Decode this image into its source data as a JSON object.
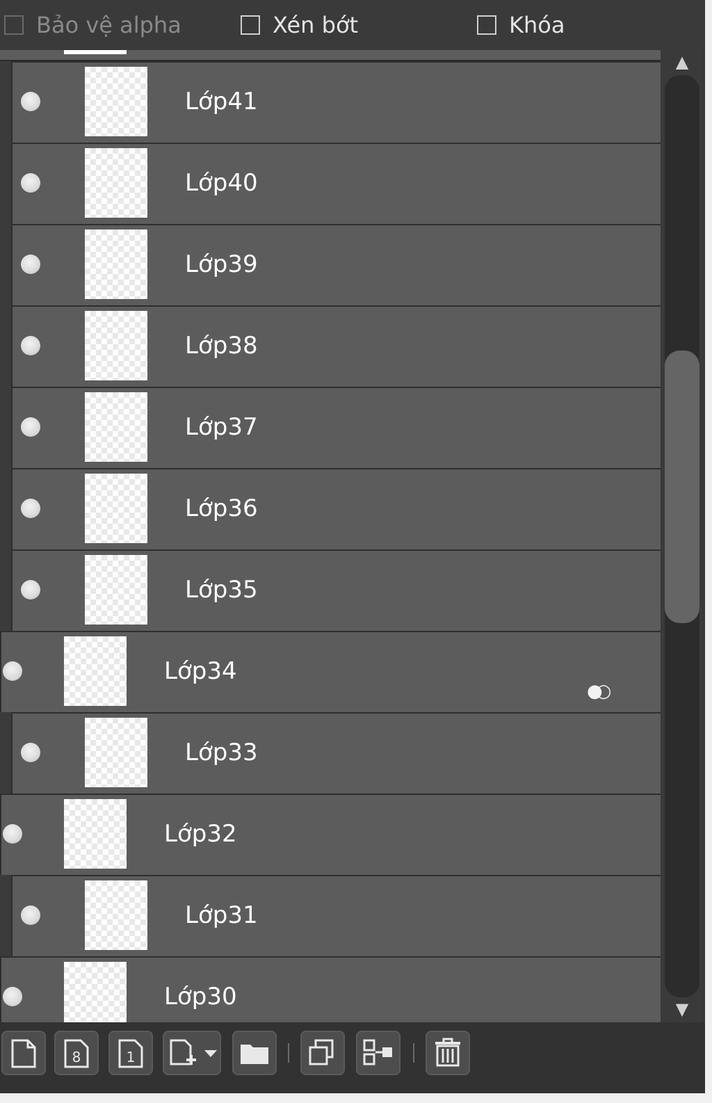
{
  "options": [
    {
      "label": "Bảo vệ alpha",
      "checked": false,
      "enabled": false
    },
    {
      "label": "Xén bớt",
      "checked": false,
      "enabled": true
    },
    {
      "label": "Khóa",
      "checked": false,
      "enabled": true
    }
  ],
  "layers": [
    {
      "name": "Lớp41",
      "indent": "child"
    },
    {
      "name": "Lớp40",
      "indent": "child"
    },
    {
      "name": "Lớp39",
      "indent": "child"
    },
    {
      "name": "Lớp38",
      "indent": "child"
    },
    {
      "name": "Lớp37",
      "indent": "child"
    },
    {
      "name": "Lớp36",
      "indent": "child"
    },
    {
      "name": "Lớp35",
      "indent": "child"
    },
    {
      "name": "Lớp34",
      "indent": "top",
      "blend_icon": "blend-mode-icon"
    },
    {
      "name": "Lớp33",
      "indent": "child"
    },
    {
      "name": "Lớp32",
      "indent": "top"
    },
    {
      "name": "Lớp31",
      "indent": "child"
    },
    {
      "name": "Lớp30",
      "indent": "top"
    }
  ],
  "toolbar": [
    "new-layer-icon",
    "new-8bit-layer-icon",
    "new-1bit-layer-icon",
    "add-layer-dropdown-icon",
    "folder-icon",
    "duplicate-layer-icon",
    "merge-down-icon",
    "delete-icon"
  ],
  "scroll": {
    "position_fraction": 0.33,
    "visible_fraction": 0.3
  }
}
